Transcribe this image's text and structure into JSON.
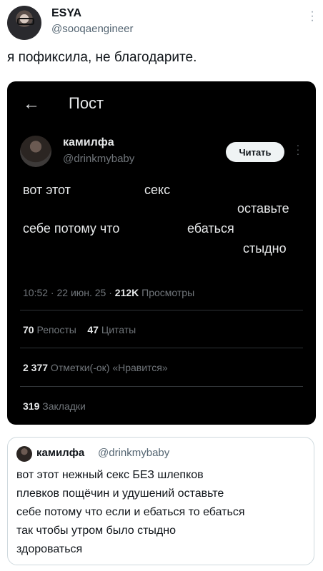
{
  "author": {
    "name": "ESYA",
    "handle": "@sooqaengineer"
  },
  "tweet_text": "я пофиксила, не благодарите.",
  "screenshot": {
    "title": "Пост",
    "user": {
      "name": "камилфа",
      "handle": "@drinkmybaby"
    },
    "follow_label": "Читать",
    "words": [
      "вот этот",
      "секс",
      "оставьте",
      "себе потому что",
      "ебаться",
      "стыдно"
    ],
    "meta": {
      "time": "10:52 · 22 июн. 25 · ",
      "views": "212K",
      "views_label": " Просмотры"
    },
    "stats": {
      "reposts": "70",
      "reposts_label": " Репосты",
      "quotes": "47",
      "quotes_label": " Цитаты",
      "likes": "2 377",
      "likes_label": " Отметки(-ок) «Нравится»",
      "bookmarks": "319",
      "bookmarks_label": " Закладки"
    }
  },
  "quote": {
    "name": "камилфа",
    "handle": "@drinkmybaby",
    "lines": [
      "вот этот нежный секс БЕЗ шлепков",
      "плевков пощёчин и удушений оставьте",
      "себе потому что если и ебаться то ебаться",
      "так чтобы утром было стыдно",
      "здороваться"
    ]
  },
  "colors": {
    "dark_bg": "#000000",
    "muted": "#71767b",
    "border": "#cfd9de"
  }
}
